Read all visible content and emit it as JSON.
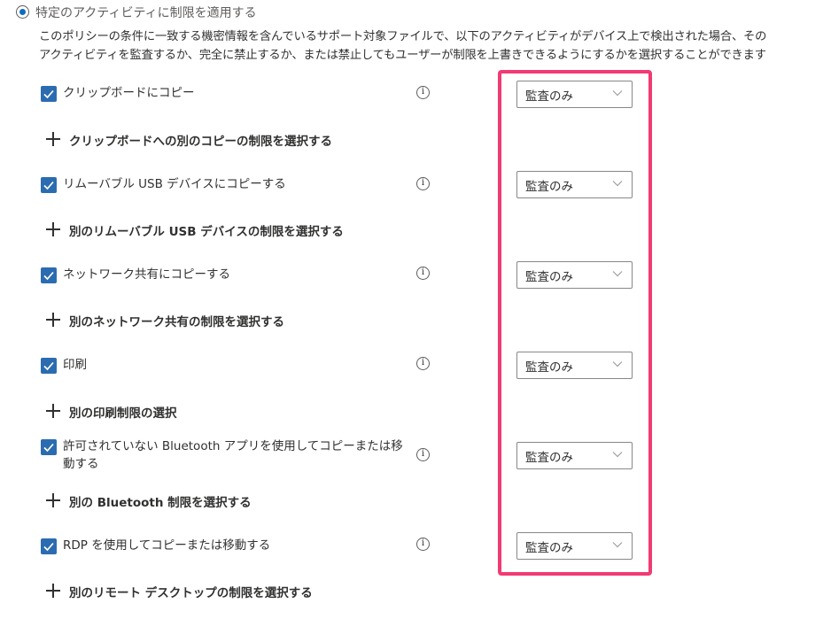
{
  "header": {
    "radio_label": "特定のアクティビティに制限を適用する",
    "description_line1": "このポリシーの条件に一致する機密情報を含んでいるサポート対象ファイルで、以下のアクティビティがデバイス上で検出された場合、その",
    "description_line2": "アクティビティを監査するか、完全に禁止するか、または禁止してもユーザーが制限を上書きできるようにするかを選択することができます"
  },
  "activities": [
    {
      "label": "クリップボードにコピー",
      "checked": true,
      "restriction": "監査のみ",
      "add_label": "クリップボードへの別のコピーの制限を選択する"
    },
    {
      "label": "リムーバブル USB デバイスにコピーする",
      "checked": true,
      "restriction": "監査のみ",
      "add_label": "別のリムーバブル USB デバイスの制限を選択する"
    },
    {
      "label": "ネットワーク共有にコピーする",
      "checked": true,
      "restriction": "監査のみ",
      "add_label": "別のネットワーク共有の制限を選択する"
    },
    {
      "label": "印刷",
      "checked": true,
      "restriction": "監査のみ",
      "add_label": "別の印刷制限の選択"
    },
    {
      "label_line1": "許可されていない Bluetooth アプリを使用してコピーまたは移",
      "label_line2": "動する",
      "checked": true,
      "restriction": "監査のみ",
      "add_label": "別の Bluetooth 制限を選択する"
    },
    {
      "label": "RDP を使用してコピーまたは移動する",
      "checked": true,
      "restriction": "監査のみ",
      "add_label": "別のリモート デスクトップの制限を選択する"
    }
  ],
  "info_glyph": "i",
  "colors": {
    "checkbox": "#2b6cb0",
    "highlight_border": "#f23a73",
    "radio_selected": "#0f6cbd"
  }
}
